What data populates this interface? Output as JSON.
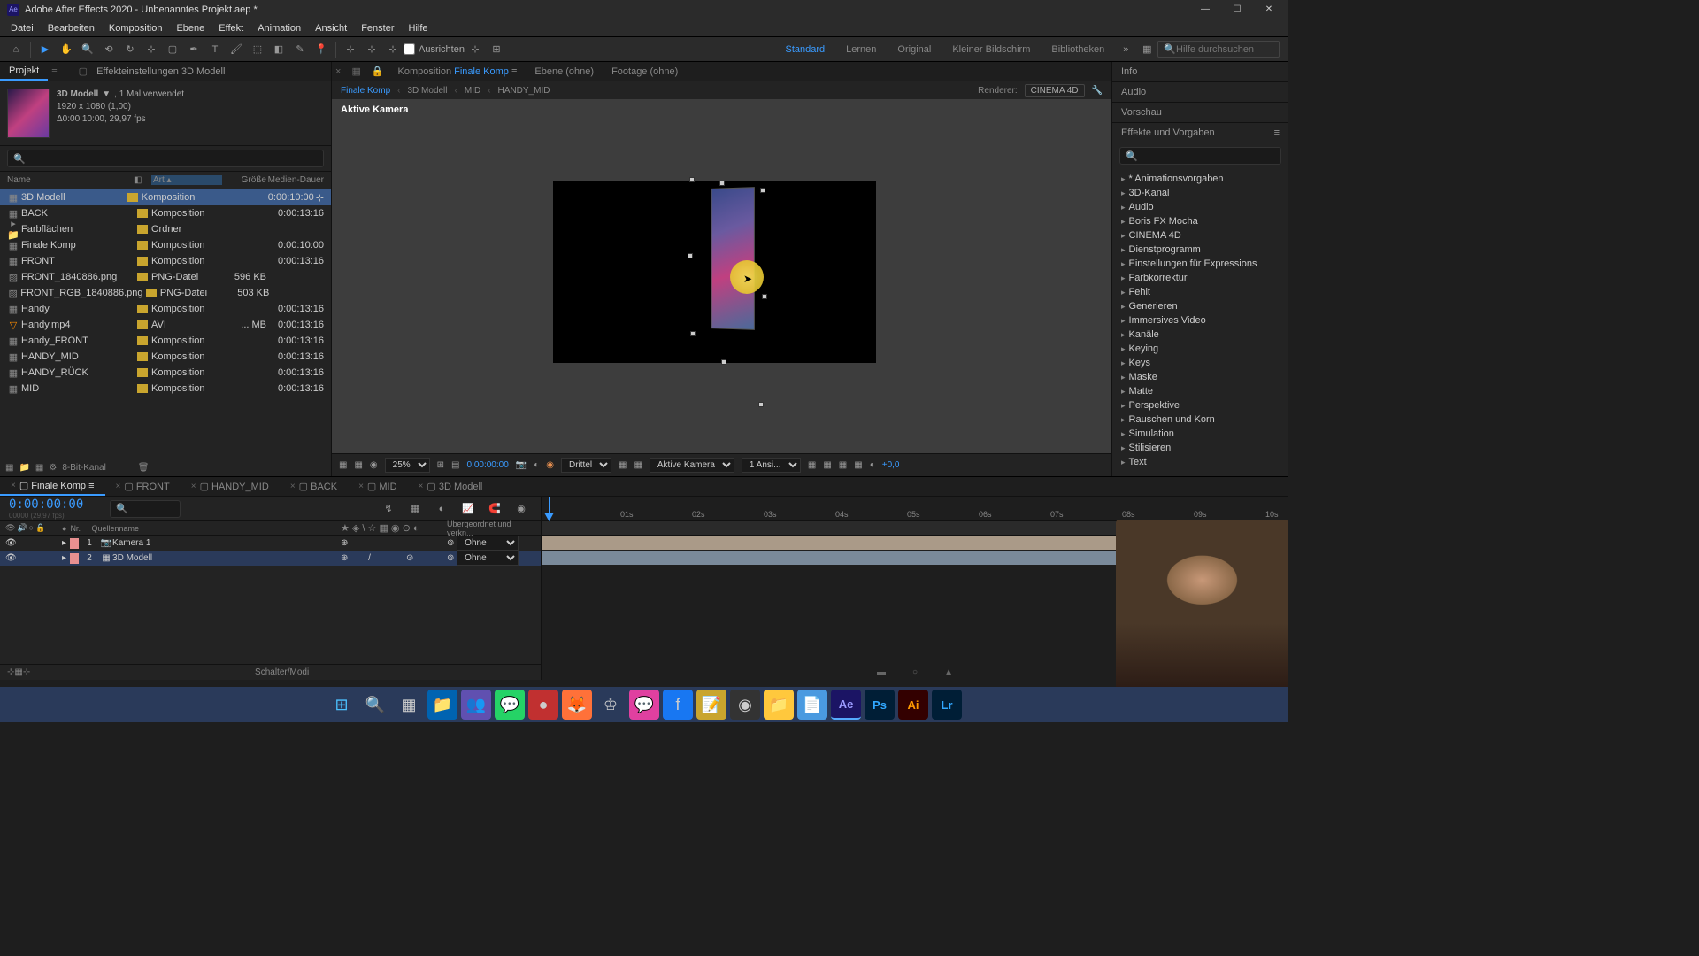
{
  "titlebar": {
    "app_icon": "Ae",
    "title": "Adobe After Effects 2020 - Unbenanntes Projekt.aep *"
  },
  "menubar": [
    "Datei",
    "Bearbeiten",
    "Komposition",
    "Ebene",
    "Effekt",
    "Animation",
    "Ansicht",
    "Fenster",
    "Hilfe"
  ],
  "toolbar": {
    "ausrichten": "Ausrichten"
  },
  "workspaces": {
    "items": [
      "Standard",
      "Lernen",
      "Original",
      "Kleiner Bildschirm",
      "Bibliotheken"
    ],
    "active_index": 0,
    "help_placeholder": "Hilfe durchsuchen"
  },
  "project_panel": {
    "tabs": [
      "Projekt",
      "Effekteinstellungen 3D Modell"
    ],
    "asset_name": "3D Modell",
    "asset_usage": ", 1 Mal verwendet",
    "asset_dims": "1920 x 1080 (1,00)",
    "asset_dur": "Δ0:00:10:00, 29,97 fps",
    "columns": {
      "name": "Name",
      "art": "Art",
      "size": "Größe",
      "dur": "Medien-Dauer"
    },
    "rows": [
      {
        "icon": "▦",
        "name": "3D Modell",
        "label": true,
        "art": "Komposition",
        "size": "",
        "dur": "0:00:10:00",
        "selected": true
      },
      {
        "icon": "▦",
        "name": "BACK",
        "label": true,
        "art": "Komposition",
        "size": "",
        "dur": "0:00:13:16"
      },
      {
        "icon": "▸",
        "name": "Farbflächen",
        "label": true,
        "art": "Ordner",
        "size": "",
        "dur": "",
        "folder": true
      },
      {
        "icon": "▦",
        "name": "Finale Komp",
        "label": true,
        "art": "Komposition",
        "size": "",
        "dur": "0:00:10:00"
      },
      {
        "icon": "▦",
        "name": "FRONT",
        "label": true,
        "art": "Komposition",
        "size": "",
        "dur": "0:00:13:16"
      },
      {
        "icon": "▨",
        "name": "FRONT_1840886.png",
        "label": true,
        "art": "PNG-Datei",
        "size": "596 KB",
        "dur": ""
      },
      {
        "icon": "▨",
        "name": "FRONT_RGB_1840886.png",
        "label": true,
        "art": "PNG-Datei",
        "size": "503 KB",
        "dur": ""
      },
      {
        "icon": "▦",
        "name": "Handy",
        "label": true,
        "art": "Komposition",
        "size": "",
        "dur": "0:00:13:16"
      },
      {
        "icon": "▽",
        "name": "Handy.mp4",
        "label": true,
        "art": "AVI",
        "size": "... MB",
        "dur": "0:00:13:16",
        "orange": true
      },
      {
        "icon": "▦",
        "name": "Handy_FRONT",
        "label": true,
        "art": "Komposition",
        "size": "",
        "dur": "0:00:13:16"
      },
      {
        "icon": "▦",
        "name": "HANDY_MID",
        "label": true,
        "art": "Komposition",
        "size": "",
        "dur": "0:00:13:16"
      },
      {
        "icon": "▦",
        "name": "HANDY_RÜCK",
        "label": true,
        "art": "Komposition",
        "size": "",
        "dur": "0:00:13:16"
      },
      {
        "icon": "▦",
        "name": "MID",
        "label": true,
        "art": "Komposition",
        "size": "",
        "dur": "0:00:13:16"
      }
    ],
    "footer_bits": "8-Bit-Kanal"
  },
  "comp_panel": {
    "tabs": [
      {
        "label": "Komposition",
        "accent": "Finale Komp",
        "active": true
      },
      {
        "label": "Ebene (ohne)"
      },
      {
        "label": "Footage (ohne)"
      }
    ],
    "breadcrumb": [
      "Finale Komp",
      "3D Modell",
      "MID",
      "HANDY_MID"
    ],
    "renderer_label": "Renderer:",
    "renderer": "CINEMA 4D",
    "viewport_label": "Aktive Kamera",
    "footer": {
      "zoom": "25%",
      "timecode": "0:00:00:00",
      "quality": "Drittel",
      "camera": "Aktive Kamera",
      "views": "1 Ansi...",
      "exposure": "+0,0"
    }
  },
  "right_panel": {
    "tabs": [
      "Info",
      "Audio",
      "Vorschau"
    ],
    "effects_tab": "Effekte und Vorgaben",
    "effects": [
      "* Animationsvorgaben",
      "3D-Kanal",
      "Audio",
      "Boris FX Mocha",
      "CINEMA 4D",
      "Dienstprogramm",
      "Einstellungen für Expressions",
      "Farbkorrektur",
      "Fehlt",
      "Generieren",
      "Immersives Video",
      "Kanäle",
      "Keying",
      "Keys",
      "Maske",
      "Matte",
      "Perspektive",
      "Rauschen und Korn",
      "Simulation",
      "Stilisieren",
      "Text"
    ]
  },
  "timeline": {
    "tabs": [
      "Finale Komp",
      "FRONT",
      "HANDY_MID",
      "BACK",
      "MID",
      "3D Modell"
    ],
    "active_index": 0,
    "timecode": "0:00:00:00",
    "sub_timecode": "00000 (29,97 fps)",
    "header_nr": "Nr.",
    "header_name": "Quellenname",
    "header_parent": "Übergeordnet und verkn...",
    "layers": [
      {
        "nr": "1",
        "name": "Kamera 1",
        "icon": "📷",
        "parent": "Ohne"
      },
      {
        "nr": "2",
        "name": "3D Modell",
        "icon": "▦",
        "parent": "Ohne",
        "selected": true
      }
    ],
    "time_labels": [
      "01s",
      "02s",
      "03s",
      "04s",
      "05s",
      "06s",
      "07s",
      "08s",
      "09s",
      "10s"
    ],
    "footer_label": "Schalter/Modi"
  }
}
